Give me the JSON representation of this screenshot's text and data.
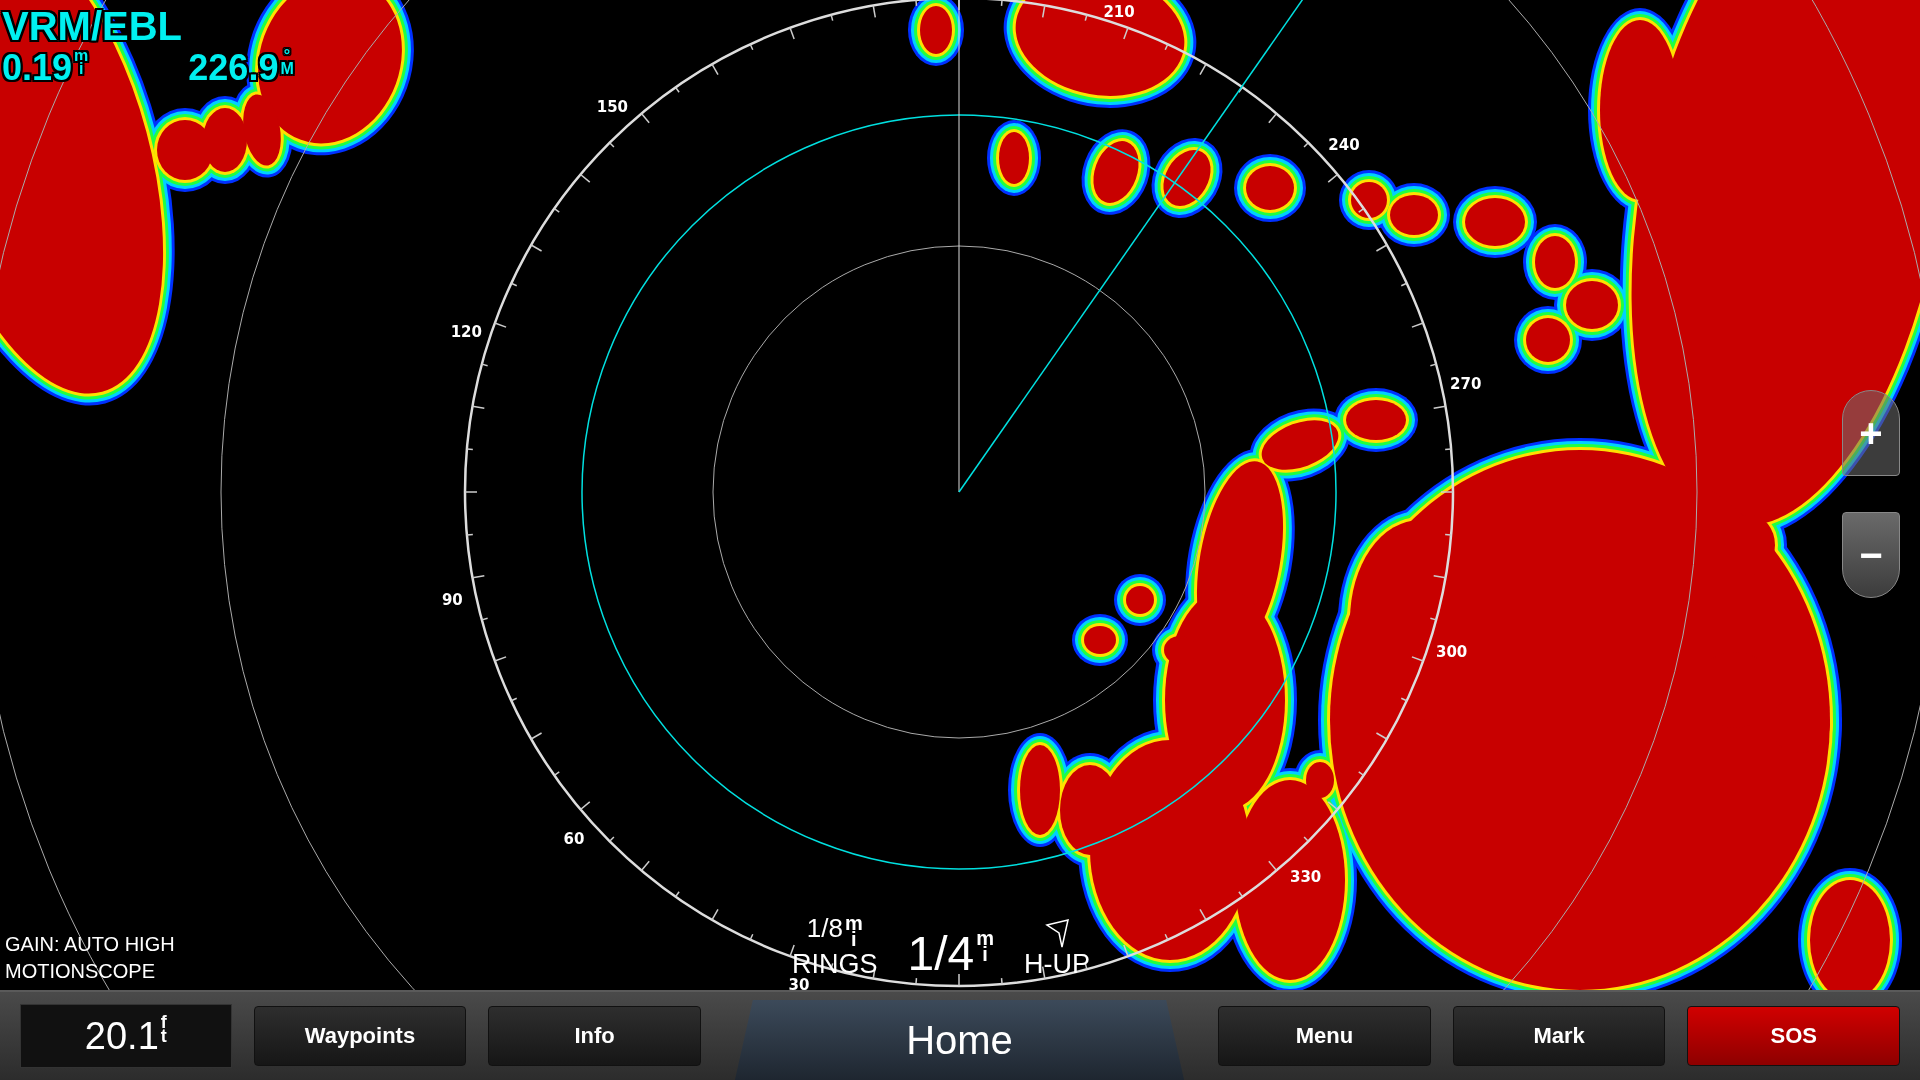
{
  "vrm_ebl": {
    "title": "VRM/EBL",
    "range": {
      "value": "0.19",
      "unit": [
        "m",
        "i"
      ]
    },
    "bearing": {
      "value": "226.9",
      "unit": [
        "°",
        "M"
      ]
    }
  },
  "bearing_scale": [
    "30",
    "60",
    "90",
    "120",
    "150",
    "210",
    "240",
    "270",
    "300",
    "330"
  ],
  "status": {
    "gain": "GAIN: AUTO HIGH",
    "mode": "MOTIONSCOPE"
  },
  "range_info": {
    "rings": {
      "value": "1/8",
      "unit": [
        "m",
        "i"
      ],
      "label": "RINGS"
    },
    "range": {
      "value": "1/4",
      "unit": [
        "m",
        "i"
      ]
    },
    "orientation": "H-UP"
  },
  "zoom_buttons": [
    "+",
    "−"
  ],
  "depth": {
    "value": "20.1",
    "unit": [
      "f",
      "t"
    ]
  },
  "buttons": [
    {
      "label": "Waypoints",
      "kind": "button"
    },
    {
      "label": "Info",
      "kind": "button"
    },
    {
      "label": "Home",
      "kind": "home"
    },
    {
      "label": "Menu",
      "kind": "button"
    },
    {
      "label": "Mark",
      "kind": "button"
    },
    {
      "label": "SOS",
      "kind": "alert"
    }
  ]
}
